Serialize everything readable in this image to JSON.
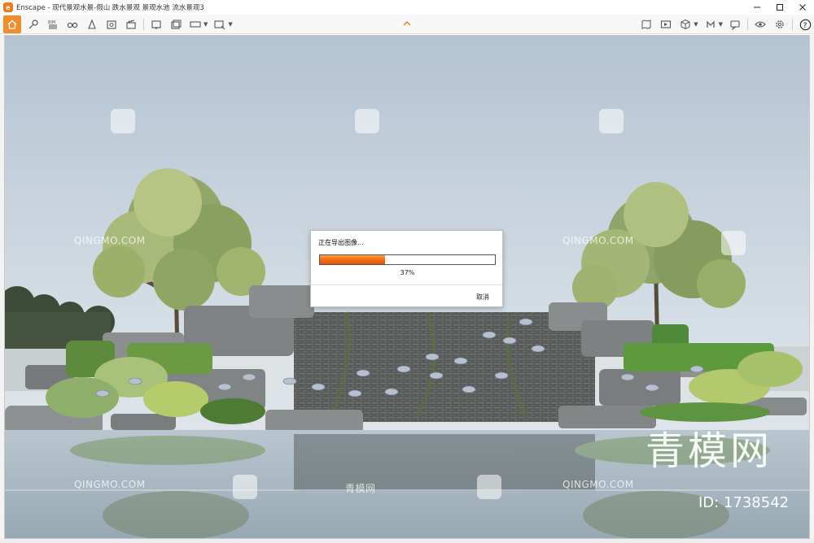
{
  "window": {
    "app_icon": "enscape-logo-icon",
    "title": "Enscape - 现代景观水景-假山 跌水景观 景观水池 流水景观3",
    "controls": [
      "minimize-icon",
      "maximize-icon",
      "close-icon"
    ]
  },
  "toolbar": {
    "left_icons": [
      "home-icon",
      "location-pin-icon",
      "bim-icon",
      "binoculars-icon",
      "upload-icon",
      "export-icon",
      "clapper-icon",
      "screenshot-icon",
      "batch-render-icon",
      "panorama-icon",
      "exe-export-icon"
    ],
    "center_icon": "collapse-chevron-icon",
    "right_icons": [
      "map-icon",
      "video-editor-icon",
      "asset-library-icon",
      "material-editor-icon",
      "collaborate-icon",
      "visual-settings-icon",
      "settings-icon",
      "help-icon"
    ]
  },
  "dialog": {
    "title": "正在导出图像...",
    "progress": 0.37,
    "progress_label": "37%",
    "cancel_label": "取消"
  },
  "watermarks": {
    "site": "QINGMO.COM",
    "brand_small": "青模网",
    "brand_big": "青模网",
    "id_label": "ID: 1738542"
  },
  "colors": {
    "accent": "#f08c2e",
    "progress": "#f36b10",
    "sky_top": "#b8c6d4",
    "water": "#a9b8c2"
  }
}
